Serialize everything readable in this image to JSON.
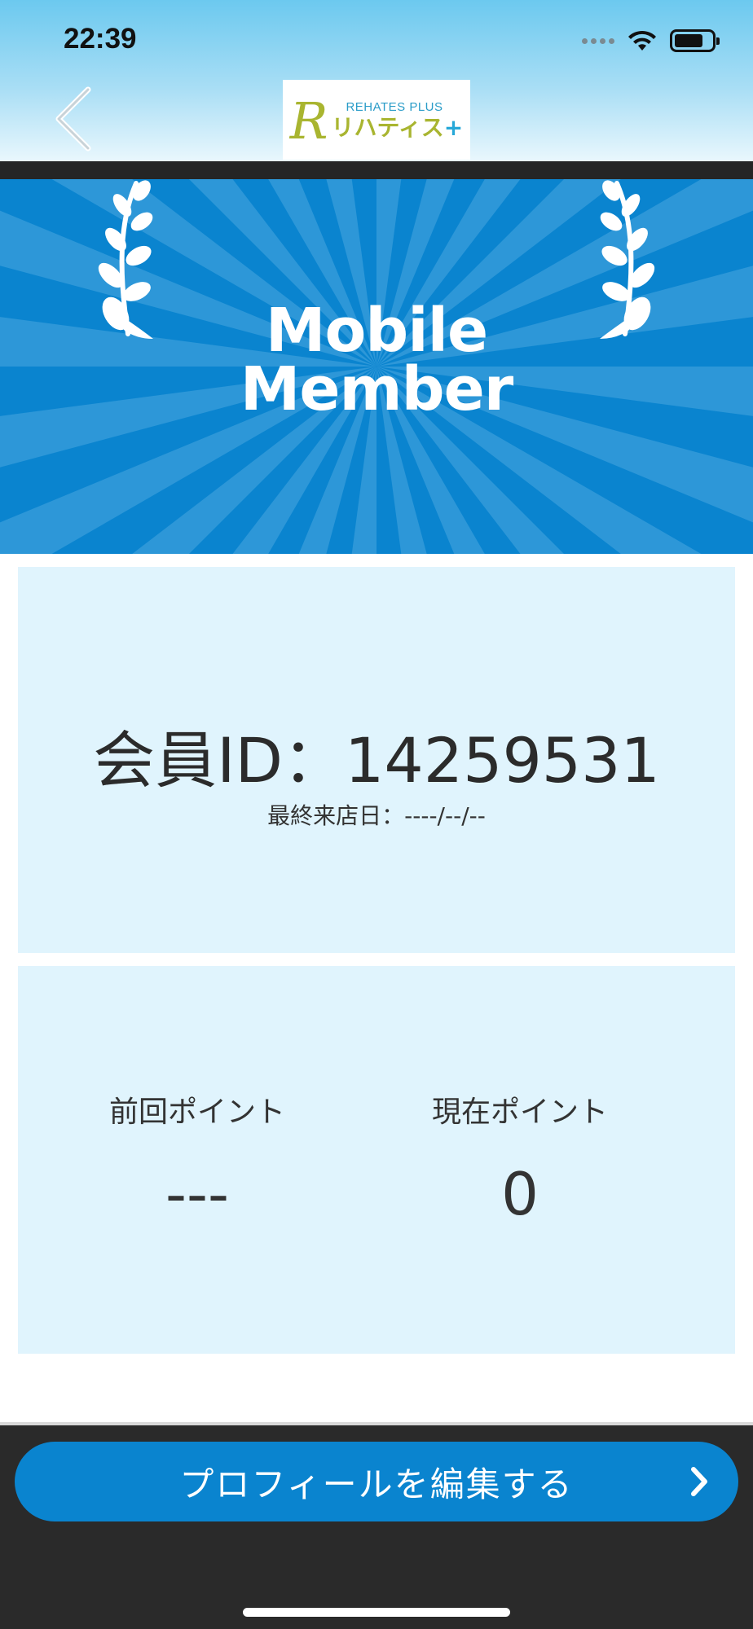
{
  "status_bar": {
    "time": "22:39",
    "icons": [
      "signal-icon",
      "wifi-icon",
      "battery-icon"
    ]
  },
  "header": {
    "back_icon": "chevron-left-icon",
    "logo": {
      "mark": "R",
      "en": "REHATES PLUS",
      "jp_main": "リハティス",
      "jp_plus": "+"
    }
  },
  "banner": {
    "line1": "Mobile",
    "line2": "Member",
    "colors": {
      "background": "#0a84cf",
      "rays": "#2d97d8"
    }
  },
  "member": {
    "id_text": "会員ID：14259531",
    "last_visit": "最終来店日：----/--/--"
  },
  "points": {
    "previous_label": "前回ポイント",
    "previous_value": "---",
    "current_label": "現在ポイント",
    "current_value": "0"
  },
  "footer": {
    "edit_button_label": "プロフィールを編集する",
    "edit_button_icon": "chevron-right-icon"
  }
}
